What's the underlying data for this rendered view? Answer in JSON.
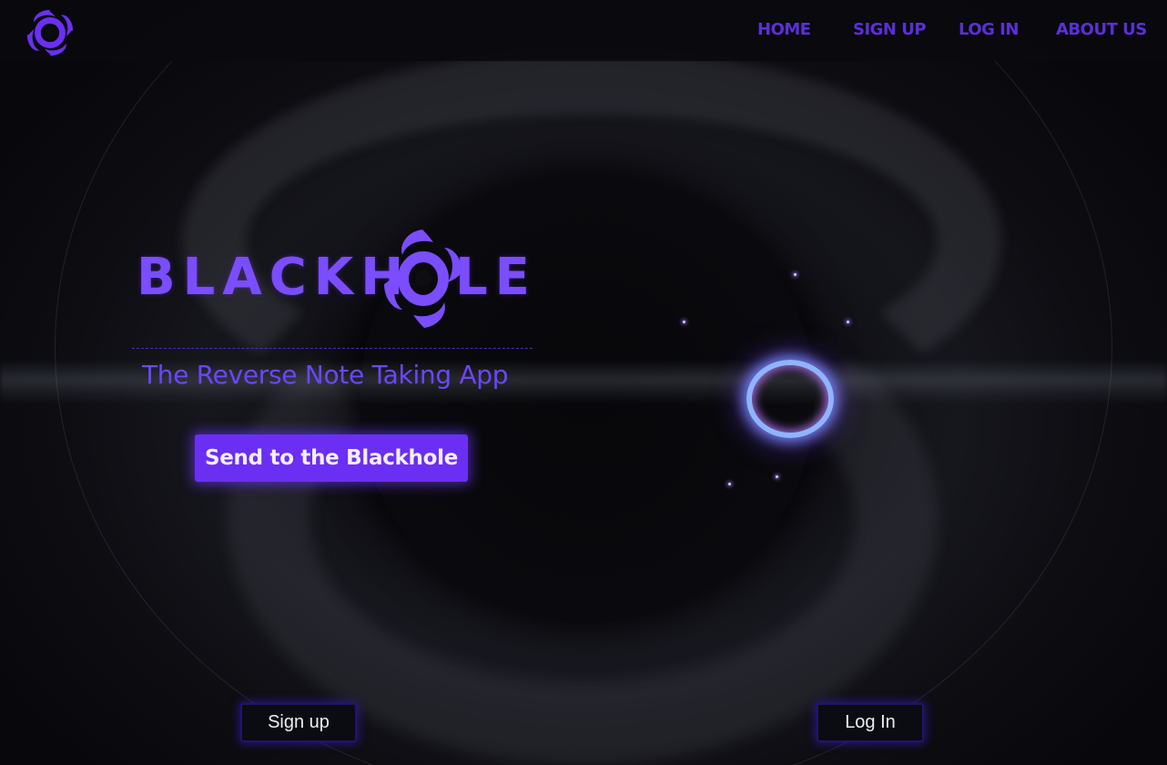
{
  "app": {
    "name": "Blackhole"
  },
  "navbar": {
    "links": [
      {
        "label": "HOME"
      },
      {
        "label": "SIGN UP"
      },
      {
        "label": "LOG IN"
      },
      {
        "label": "ABOUT US"
      }
    ]
  },
  "hero": {
    "wordmark_left": "BLACKH",
    "wordmark_right": "LE",
    "tagline": "The Reverse Note Taking App",
    "cta_label": "Send to the Blackhole"
  },
  "footer_actions": {
    "signup_label": "Sign up",
    "login_label": "Log In"
  },
  "colors": {
    "accent": "#6a2ff2",
    "nav_text": "#5b2fd8",
    "tagline": "#6b46ff",
    "background": "#0b0b10"
  },
  "icons": {
    "logo": "blackhole-swirl-icon"
  }
}
